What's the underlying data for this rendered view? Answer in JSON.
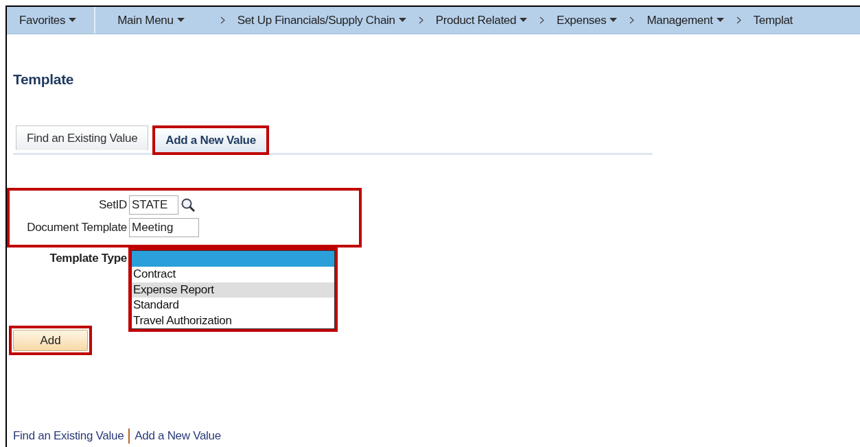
{
  "nav": {
    "favorites": {
      "label": "Favorites",
      "has_menu": true
    },
    "items": [
      {
        "label": "Main Menu",
        "has_menu": true
      },
      {
        "label": "Set Up Financials/Supply Chain",
        "has_menu": true
      },
      {
        "label": "Product Related",
        "has_menu": true
      },
      {
        "label": "Expenses",
        "has_menu": true
      },
      {
        "label": "Management",
        "has_menu": true
      },
      {
        "label": "Templat",
        "has_menu": false
      }
    ]
  },
  "page_title": "Template",
  "tabs": [
    {
      "label": "Find an Existing Value",
      "selected": false,
      "highlighted": false
    },
    {
      "label": "Add a New Value",
      "selected": true,
      "highlighted": true
    }
  ],
  "form": {
    "highlighted": true,
    "fields": [
      {
        "label": "SetID",
        "value": "STATE",
        "kind": "lookup"
      },
      {
        "label": "Document Template",
        "value": "Meeting",
        "kind": "text"
      }
    ]
  },
  "template_type": {
    "label": "Template Type",
    "highlighted": true,
    "blank_selected": true,
    "options": [
      {
        "label": "Contract",
        "hovered": false
      },
      {
        "label": "Expense Report",
        "hovered": true
      },
      {
        "label": "Standard",
        "hovered": false
      },
      {
        "label": "Travel Authorization",
        "hovered": false
      }
    ]
  },
  "add_button": {
    "label": "Add",
    "highlighted": true
  },
  "footer_links": [
    "Find an Existing Value",
    "Add a New Value"
  ]
}
